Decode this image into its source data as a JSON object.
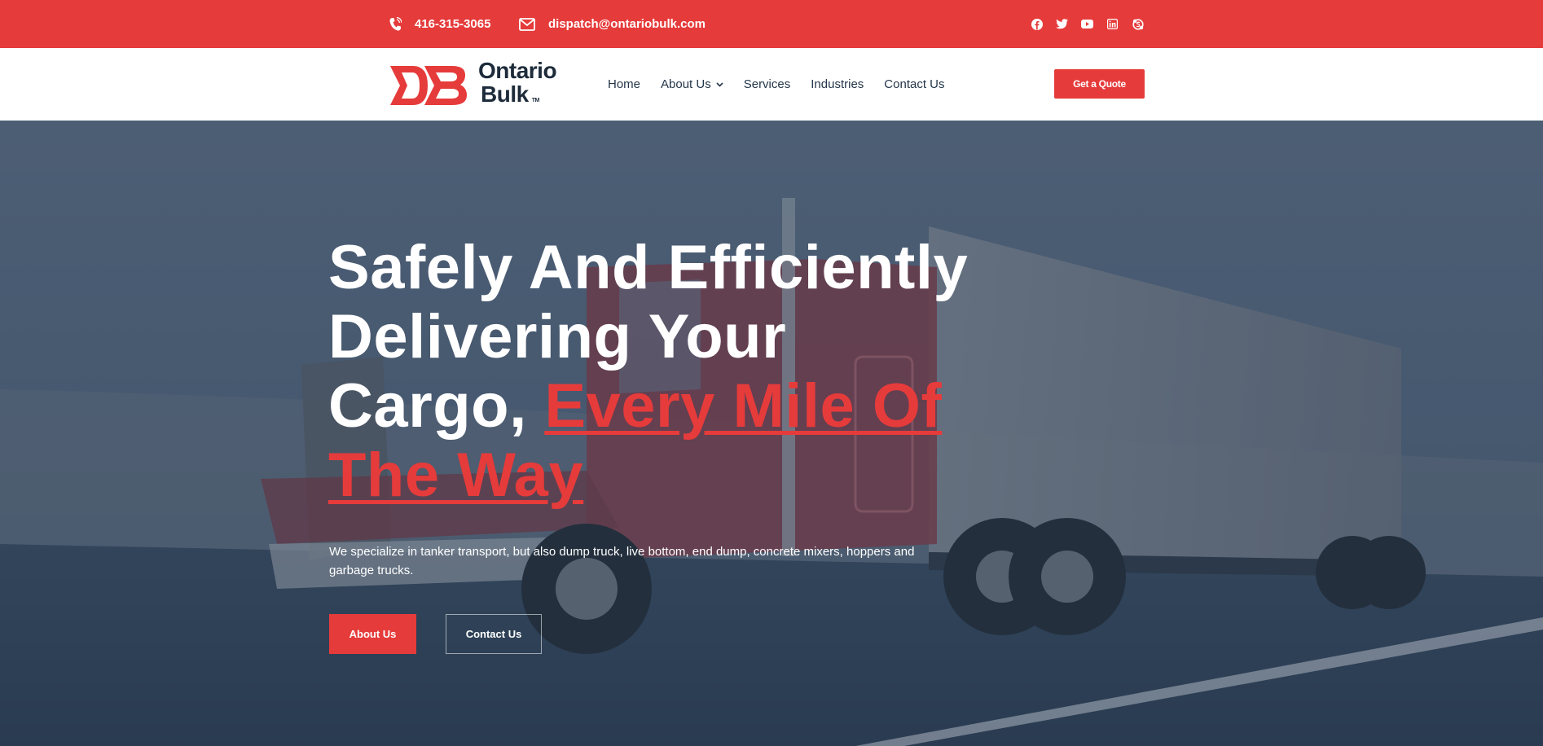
{
  "topbar": {
    "phone": "416-315-3065",
    "email": "dispatch@ontariobulk.com",
    "phone_icon": "phone-icon",
    "email_icon": "envelope-icon",
    "socials": [
      "facebook-icon",
      "twitter-icon",
      "youtube-icon",
      "linkedin-icon",
      "skype-icon"
    ]
  },
  "header": {
    "logo": {
      "line1": "Ontario",
      "line2": "Bulk",
      "tm": "TM"
    },
    "nav": [
      {
        "label": "Home"
      },
      {
        "label": "About Us",
        "has_dropdown": true
      },
      {
        "label": "Services"
      },
      {
        "label": "Industries"
      },
      {
        "label": "Contact Us"
      }
    ],
    "cta": "Get a Quote"
  },
  "hero": {
    "title_line1": "Safely And Efficiently",
    "title_line2": "Delivering Your",
    "title_line3_plain": "Cargo, ",
    "title_accent": "Every Mile Of The Way",
    "subtitle": "We specialize in tanker transport, but also dump truck, live bottom, end dump, concrete mixers, hoppers and garbage trucks.",
    "button_primary": "About Us",
    "button_secondary": "Contact Us"
  },
  "colors": {
    "brand_red": "#e63b3b",
    "dark_navy": "#1d2b3a",
    "hero_overlay": "#3c5068",
    "white": "#ffffff"
  }
}
